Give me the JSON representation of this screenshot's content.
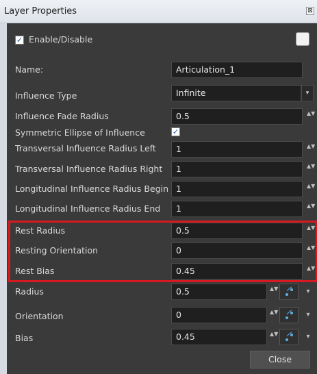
{
  "window": {
    "title": "Layer Properties",
    "close_glyph": "⊠"
  },
  "enable": {
    "label": "Enable/Disable",
    "checked": true,
    "check_glyph": "✓"
  },
  "name": {
    "label": "Name:",
    "value": "Articulation_1"
  },
  "influence_type": {
    "label": "Influence Type",
    "value": "Infinite",
    "arrow": "▾"
  },
  "fade_radius": {
    "label": "Influence Fade Radius",
    "value": "0.5"
  },
  "symmetric": {
    "label": "Symmetric Ellipse of Influence",
    "checked": true,
    "check_glyph": "✓"
  },
  "trans_left": {
    "label": "Transversal Influence Radius Left",
    "value": "1"
  },
  "trans_right": {
    "label": "Transversal Influence Radius Right",
    "value": "1"
  },
  "long_begin": {
    "label": "Longitudinal Influence Radius Begin",
    "value": "1"
  },
  "long_end": {
    "label": "Longitudinal Influence Radius End",
    "value": "1"
  },
  "rest_radius": {
    "label": "Rest Radius",
    "value": "0.5"
  },
  "resting_orientation": {
    "label": "Resting Orientation",
    "value": "0"
  },
  "rest_bias": {
    "label": "Rest Bias",
    "value": "0.45"
  },
  "radius": {
    "label": "Radius",
    "value": "0.5"
  },
  "orientation": {
    "label": "Orientation",
    "value": "0"
  },
  "bias": {
    "label": "Bias",
    "value": "0.45"
  },
  "spin_glyph": "▲▼",
  "menu_arrow": "▾",
  "close_button": {
    "label": "Close"
  },
  "colors": {
    "panel": "#3a3a3a",
    "field": "#1f1f1f",
    "highlight": "#d71920",
    "accent": "#5fb0e8"
  }
}
